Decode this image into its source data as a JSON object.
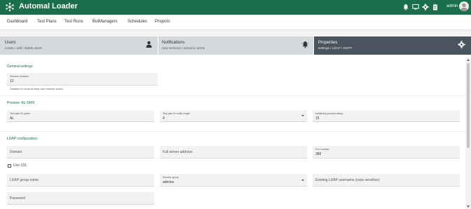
{
  "header": {
    "app_title": "Automal Loader",
    "user_name": "admin",
    "icons": [
      "logo-icon",
      "bell-icon",
      "monitor-icon",
      "gear-icon",
      "clipboard-icon",
      "avatar"
    ]
  },
  "nav": {
    "items": [
      "Dashboard",
      "Test Plans",
      "Test Runs",
      "BotManagers",
      "Schedules",
      "Projects"
    ]
  },
  "cards": [
    {
      "title": "Users",
      "subtitle": "create / edit / delete users",
      "icon": "user-icon"
    },
    {
      "title": "Notifications",
      "subtitle": "new versions / resource alerts",
      "icon": "bell-icon"
    },
    {
      "title": "Properties",
      "subtitle": "settings / LDAP / SMTP",
      "icon": "gear-icon"
    }
  ],
  "general": {
    "section_title": "General settings",
    "session_label": "Session duration",
    "session_value": "12",
    "session_hint": "Duration in hours to keep user session active."
  },
  "preview": {
    "section_title": "Preview: AL-5409",
    "prefix_label": "Test plan ID prefix",
    "prefix_value": "AL",
    "suffix_label": "Test plan ID suffix length",
    "suffix_value": "4",
    "delay_label": "Initializing process delay",
    "delay_value": "15"
  },
  "ldap": {
    "section_title": "LDAP configuration",
    "domain_placeholder": "Domain",
    "full_server_placeholder": "Full server address",
    "port_label": "Port number",
    "port_value": "389",
    "use_ssl_label": "Use SSL",
    "group_name_placeholder": "LDAP group name",
    "director_label": "Director group",
    "director_value": "admins",
    "existing_user_placeholder": "Existing LDAP username (case sensitive)",
    "password_placeholder": "Password"
  },
  "colors": {
    "brand": "#1b6e4c",
    "card_dark": "#4a545e",
    "card_light": "#d6d9dc",
    "section_title": "#1b6e4c"
  }
}
